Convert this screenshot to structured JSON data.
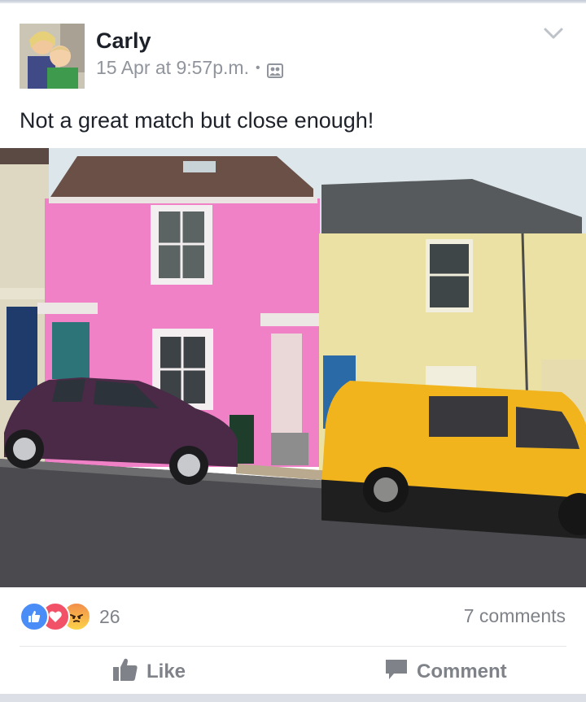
{
  "post": {
    "author": "Carly",
    "timestamp": "15 Apr at 9:57p.m.",
    "separator": "•",
    "privacy_icon": "friends-icon",
    "text": "Not a great match but close enough!",
    "photo_icon": "street-photo"
  },
  "reactions": {
    "types": [
      "like",
      "love",
      "angry"
    ],
    "count": "26",
    "comments": "7 comments"
  },
  "actions": {
    "like_label": "Like",
    "comment_label": "Comment"
  },
  "colors": {
    "like_blue": "#4a8df7",
    "love_red": "#f25268",
    "angry_orange": "#f28e4b",
    "muted_text": "#7f8389"
  }
}
